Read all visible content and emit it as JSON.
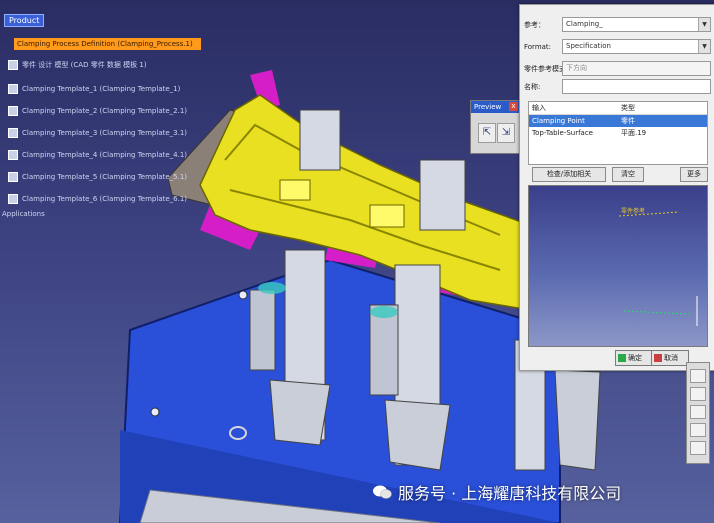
{
  "spec_tree": {
    "root_label": "Product",
    "highlighted_item": "Clamping Process Definition (Clamping_Process.1)",
    "items": [
      "Clamping Template_1 (Clamping Template_1)",
      "Clamping Template_2 (Clamping Template_2.1)",
      "Clamping Template_3 (Clamping Template_3.1)",
      "Clamping Template_4 (Clamping Template_4.1)",
      "Clamping Template_5 (Clamping Template_5.1)",
      "Clamping Template_6 (Clamping Template_6.1)"
    ],
    "second_line": "零件 设计 模型 (CAD 零件 数据 模板 1)",
    "applications_label": "Applications"
  },
  "mini_toolbar": {
    "title": "Preview",
    "close_glyph": "x"
  },
  "dialog": {
    "field1_label": "参考：",
    "field1_value": "Clamping_",
    "field2_label": "Format:",
    "field2_value": "Specification",
    "field3_label": "零件参考模式:",
    "field3_value": "下方向",
    "field4_label": "名称:",
    "field4_value": "",
    "list_headers": [
      "输入",
      "类型"
    ],
    "list_items": [
      {
        "name": "Clamping Point",
        "type": "零件"
      },
      {
        "name": "Top-Table-Surface",
        "type": "平面.19"
      }
    ],
    "button_update": "检查/添加相关",
    "button_clear": "清空",
    "button_more": "更多",
    "ok_label": "确定",
    "cancel_label": "取消",
    "preview_text": "零件参考"
  },
  "watermark": {
    "text": "服务号 · 上海耀唐科技有限公司"
  },
  "colors": {
    "background": "#3c4180",
    "part_yellow": "#e8e020",
    "part_magenta": "#d61ec8",
    "base_blue": "#2a4fd8",
    "highlight_orange": "#ff9a1a",
    "selection_blue": "#3a78d8"
  }
}
